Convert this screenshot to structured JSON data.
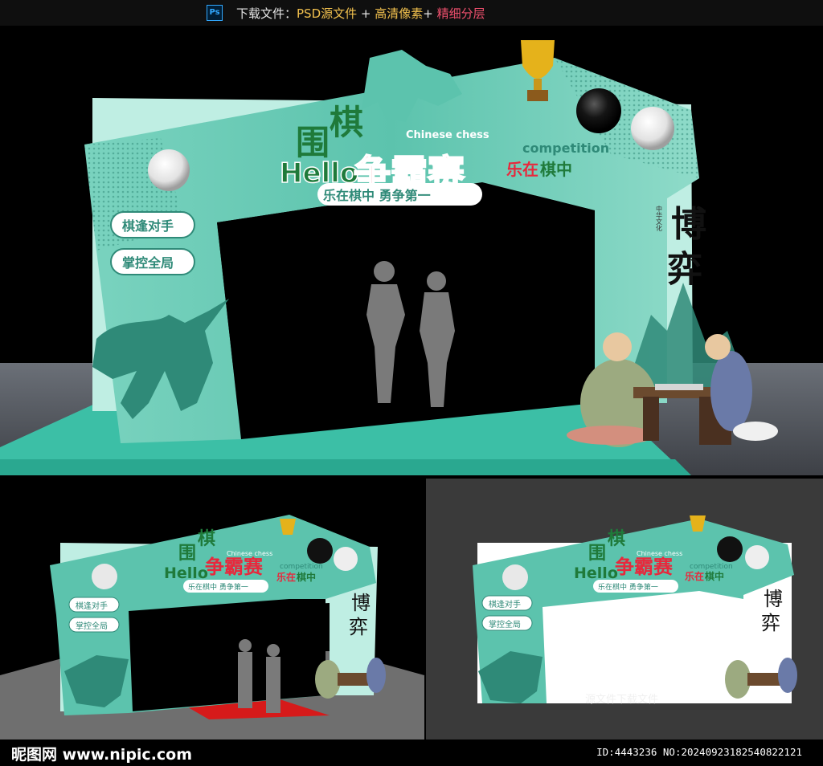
{
  "colors": {
    "teal": "#5cc3ad",
    "teal_dark": "#2f8a78",
    "teal_light": "#bfeee3",
    "green_text": "#1f7a3a",
    "red_text": "#e8283c",
    "gold": "#e5b21b",
    "carpet": "#d61a1a"
  },
  "header": {
    "app_icon": "photoshop-icon",
    "app_icon_label": "Ps",
    "prefix": "下载文件：",
    "psd": "PSD源文件",
    "plus1": " + ",
    "hd": "高清像素",
    "plus2": "+ ",
    "layers": "精细分层"
  },
  "sign": {
    "title_wei": "围",
    "title_qi": "棋",
    "hello": "Hello",
    "chinese_chess": "Chinese chess",
    "main": "争霸赛",
    "competition": "competition",
    "lezai": "乐在",
    "qizhong": "棋中",
    "slogan": "乐在棋中  勇争第一",
    "btn1": "棋逢对手",
    "btn2": "掌控全局",
    "calligraphy_1": "博",
    "calligraphy_2": "弈",
    "vertical_small": "中华文化"
  },
  "caption": "源文件下载文件",
  "footer": {
    "site": "昵图网 www.nipic.com",
    "id": "ID:4443236 NO:20240923182540822121"
  }
}
